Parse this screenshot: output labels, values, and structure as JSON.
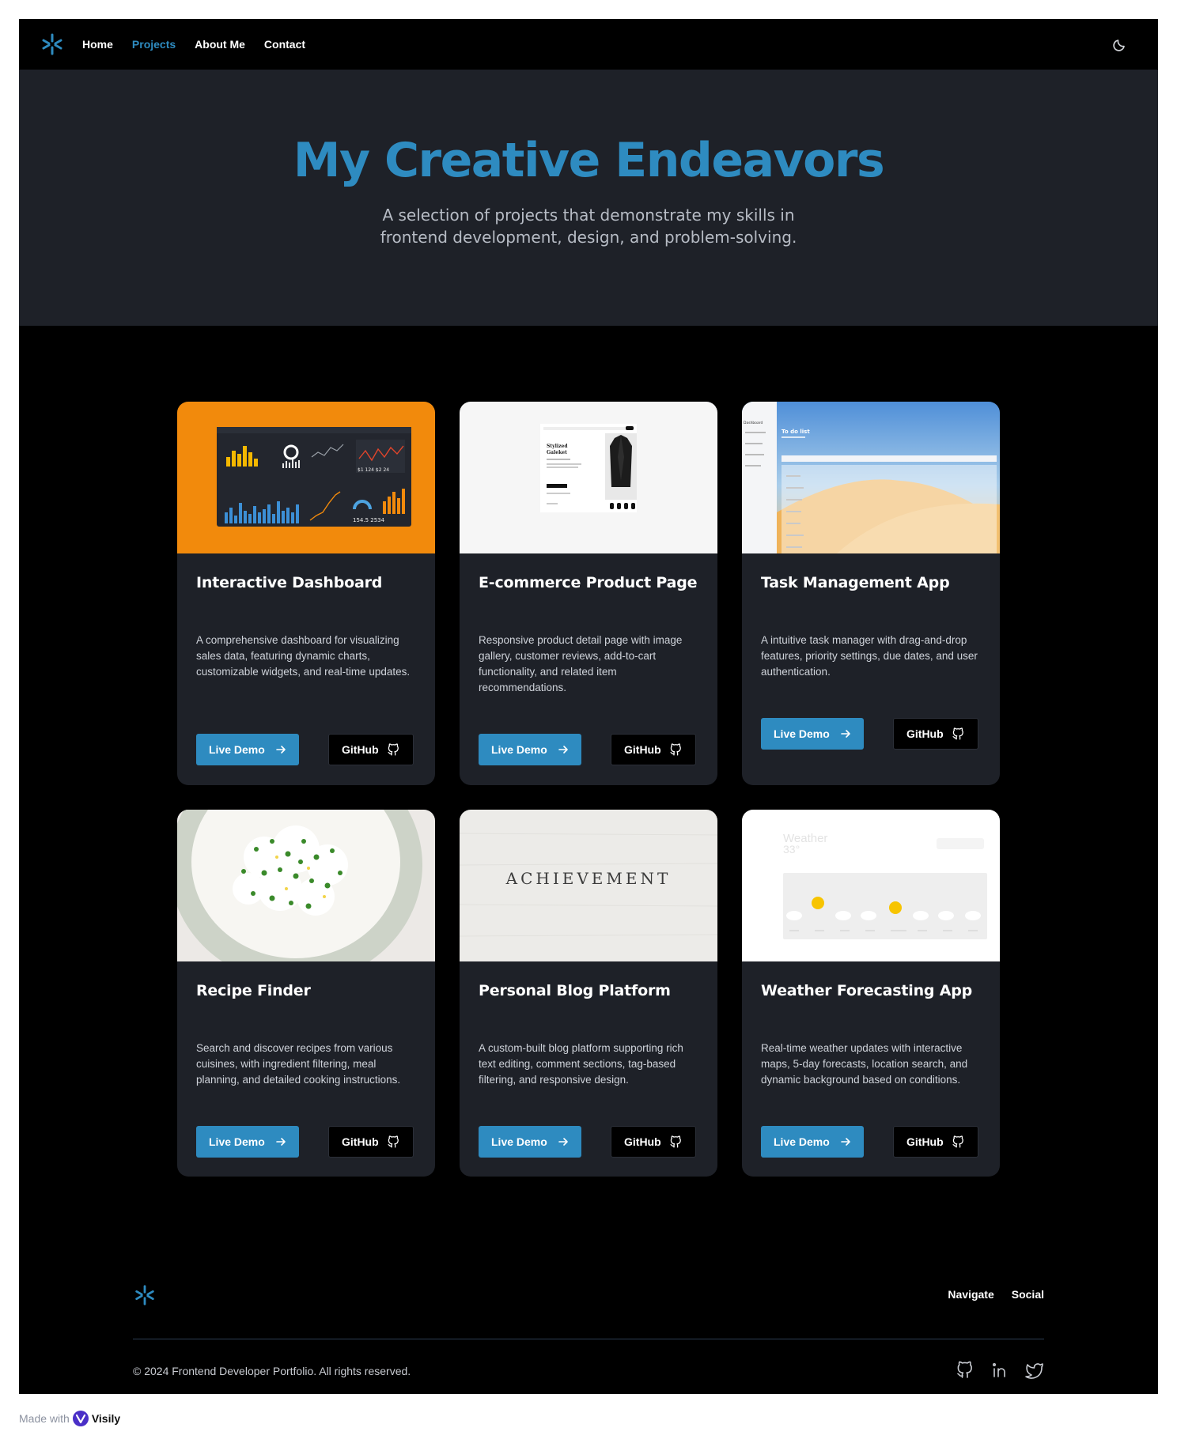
{
  "nav": {
    "logo": "asterisk-logo-icon",
    "links": [
      "Home",
      "Projects",
      "About Me",
      "Contact"
    ],
    "active": "Projects",
    "theme_toggle": "moon-icon"
  },
  "hero": {
    "title": "My Creative Endeavors",
    "subtitle": "A selection of projects that demonstrate my skills in frontend development, design, and problem-solving."
  },
  "projects": [
    {
      "title": "Interactive Dashboard",
      "description": "A comprehensive dashboard for visualizing sales data, featuring dynamic charts, customizable widgets, and real-time updates.",
      "demo_label": "Live Demo",
      "github_label": "GitHub",
      "thumb_text": [
        "$1",
        "124",
        "$2",
        "24",
        "154.5",
        "2534"
      ]
    },
    {
      "title": "E-commerce Product Page",
      "description": "Responsive product detail page with image gallery, customer reviews, add-to-cart functionality, and related item recommendations.",
      "demo_label": "Live Demo",
      "github_label": "GitHub",
      "thumb_text": [
        "Stylized",
        "Galeket"
      ]
    },
    {
      "title": "Task Management App",
      "description": "A intuitive task manager with drag-and-drop features, priority settings, due dates, and user authentication.",
      "demo_label": "Live Demo",
      "github_label": "GitHub",
      "thumb_text": [
        "To do list",
        "Dashboard"
      ]
    },
    {
      "title": "Recipe Finder",
      "description": "Search and discover recipes from various cuisines, with ingredient filtering, meal planning, and detailed cooking instructions.",
      "demo_label": "Live Demo",
      "github_label": "GitHub"
    },
    {
      "title": "Personal Blog Platform",
      "description": "A custom-built blog platform supporting rich text editing, comment sections, tag-based filtering, and responsive design.",
      "demo_label": "Live Demo",
      "github_label": "GitHub",
      "thumb_text": [
        "ACHIEVEMENT"
      ]
    },
    {
      "title": "Weather Forecasting App",
      "description": "Real-time weather updates with interactive maps, 5-day forecasts, location search, and dynamic background based on conditions.",
      "demo_label": "Live Demo",
      "github_label": "GitHub",
      "thumb_text": [
        "Weather",
        "33°"
      ]
    }
  ],
  "footer": {
    "links": [
      "Navigate",
      "Social"
    ],
    "copyright": "© 2024 Frontend Developer Portfolio. All rights reserved.",
    "social_icons": [
      "github-icon",
      "linkedin-icon",
      "twitter-icon"
    ]
  },
  "badge": {
    "prefix": "Made with",
    "brand": "Visily"
  },
  "colors": {
    "accent": "#2e8bc0",
    "page_bg": "#000000",
    "surface": "#1e2128",
    "dashboard_thumb_bg": "#f28a0c"
  }
}
